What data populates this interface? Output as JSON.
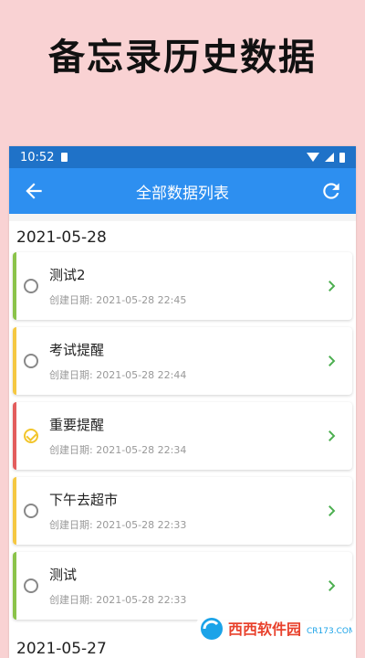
{
  "promo": {
    "headline": "备忘录历史数据"
  },
  "status_bar": {
    "time": "10:52"
  },
  "app_bar": {
    "title": "全部数据列表"
  },
  "groups": [
    {
      "date": "2021-05-28",
      "items": [
        {
          "title": "测试2",
          "created": "创建日期: 2021-05-28 22:45",
          "color": "#8bc34a",
          "checked": false
        },
        {
          "title": "考试提醒",
          "created": "创建日期: 2021-05-28 22:44",
          "color": "#f5c842",
          "checked": false
        },
        {
          "title": "重要提醒",
          "created": "创建日期: 2021-05-28 22:34",
          "color": "#e35d5d",
          "checked": true
        },
        {
          "title": "下午去超市",
          "created": "创建日期: 2021-05-28 22:33",
          "color": "#f5c842",
          "checked": false
        },
        {
          "title": " 测试",
          "created": "创建日期: 2021-05-28 22:33",
          "color": "#8bc34a",
          "checked": false
        }
      ]
    },
    {
      "date": "2021-05-27",
      "items": []
    }
  ],
  "colors": {
    "accent": "#2d8ff0",
    "status_bar": "#1f72c8",
    "chevron": "#4caf50",
    "check": "#f2c52b",
    "background": "#f9d2d3"
  },
  "watermark": {
    "text": "西西软件园",
    "subtext": "CR173.COM"
  }
}
